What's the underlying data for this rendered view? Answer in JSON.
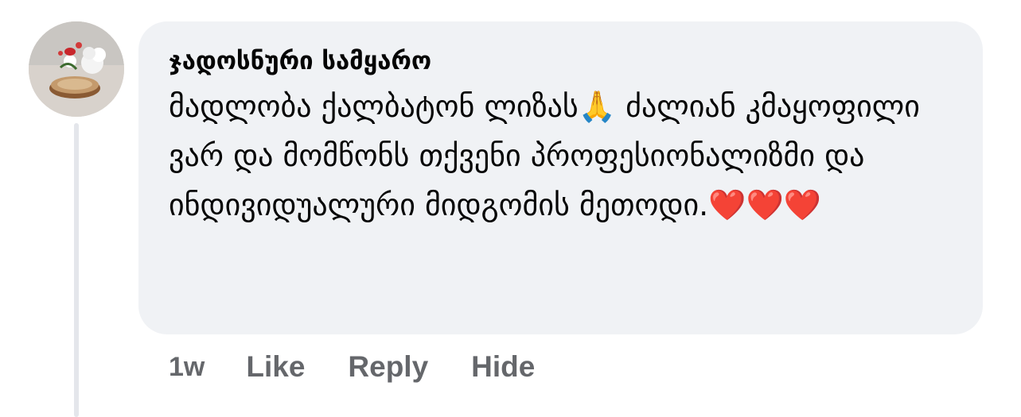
{
  "comment": {
    "author": "ჯადოსნური სამყარო",
    "text": "მადლობა ქალბატონ ლიზას🙏 ძალიან კმაყოფილი ვარ და მომწონს თქვენი პროფესიონალიზმი და ინდივიდუალური მიდგომის მეთოდი.❤️❤️❤️",
    "time": "1w",
    "actions": {
      "like": "Like",
      "reply": "Reply",
      "hide": "Hide"
    }
  },
  "colors": {
    "bubble": "#f0f2f5",
    "action_text": "#65676b",
    "thread_line": "#e4e6eb"
  }
}
